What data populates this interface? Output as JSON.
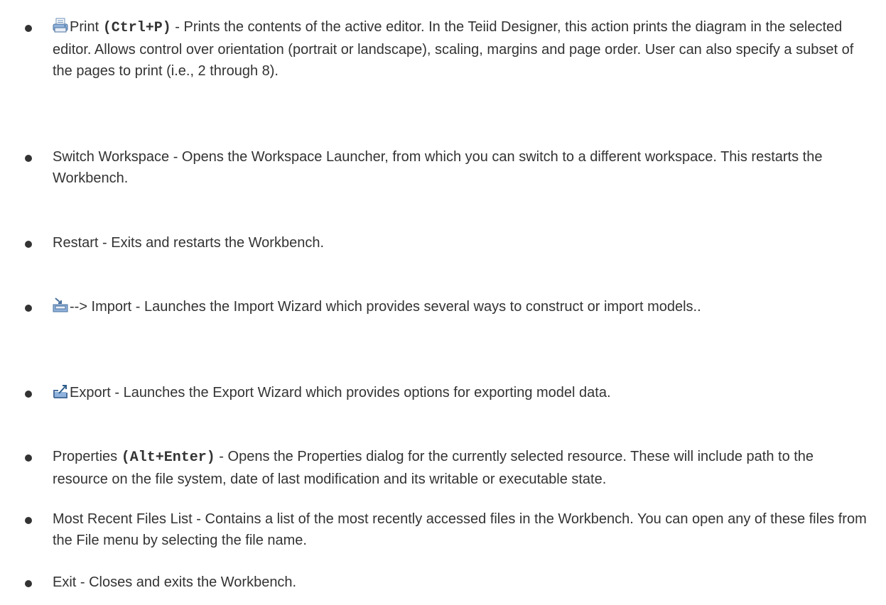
{
  "items": [
    {
      "icon": "printer-icon",
      "label": "Print",
      "shortcut": "(Ctrl+P)",
      "description": " - Prints the contents of the active editor. In the Teiid Designer, this action prints the diagram in the selected editor. Allows control over orientation (portrait or landscape), scaling, margins and page order. User can also specify a subset of the pages to print (i.e., 2 through 8)."
    },
    {
      "text": "Switch Workspace - Opens the Workspace Launcher, from which you can switch to a different workspace. This restarts the Workbench."
    },
    {
      "text": "Restart - Exits and restarts the Workbench."
    },
    {
      "icon": "import-icon",
      "text": "--> Import - Launches the Import Wizard which provides several ways to construct or import models.."
    },
    {
      "icon": "export-icon",
      "text": "Export - Launches the Export Wizard which provides options for exporting model data."
    },
    {
      "label": "Properties",
      "shortcut": "(Alt+Enter)",
      "description": " - Opens the Properties dialog for the currently selected resource. These will include path to the resource on the file system, date of last modification and its writable or executable state."
    },
    {
      "text": "Most Recent Files List - Contains a list of the most recently accessed files in the Workbench. You can open any of these files from the File menu by selecting the file name."
    },
    {
      "text": "Exit - Closes and exits the Workbench."
    }
  ]
}
